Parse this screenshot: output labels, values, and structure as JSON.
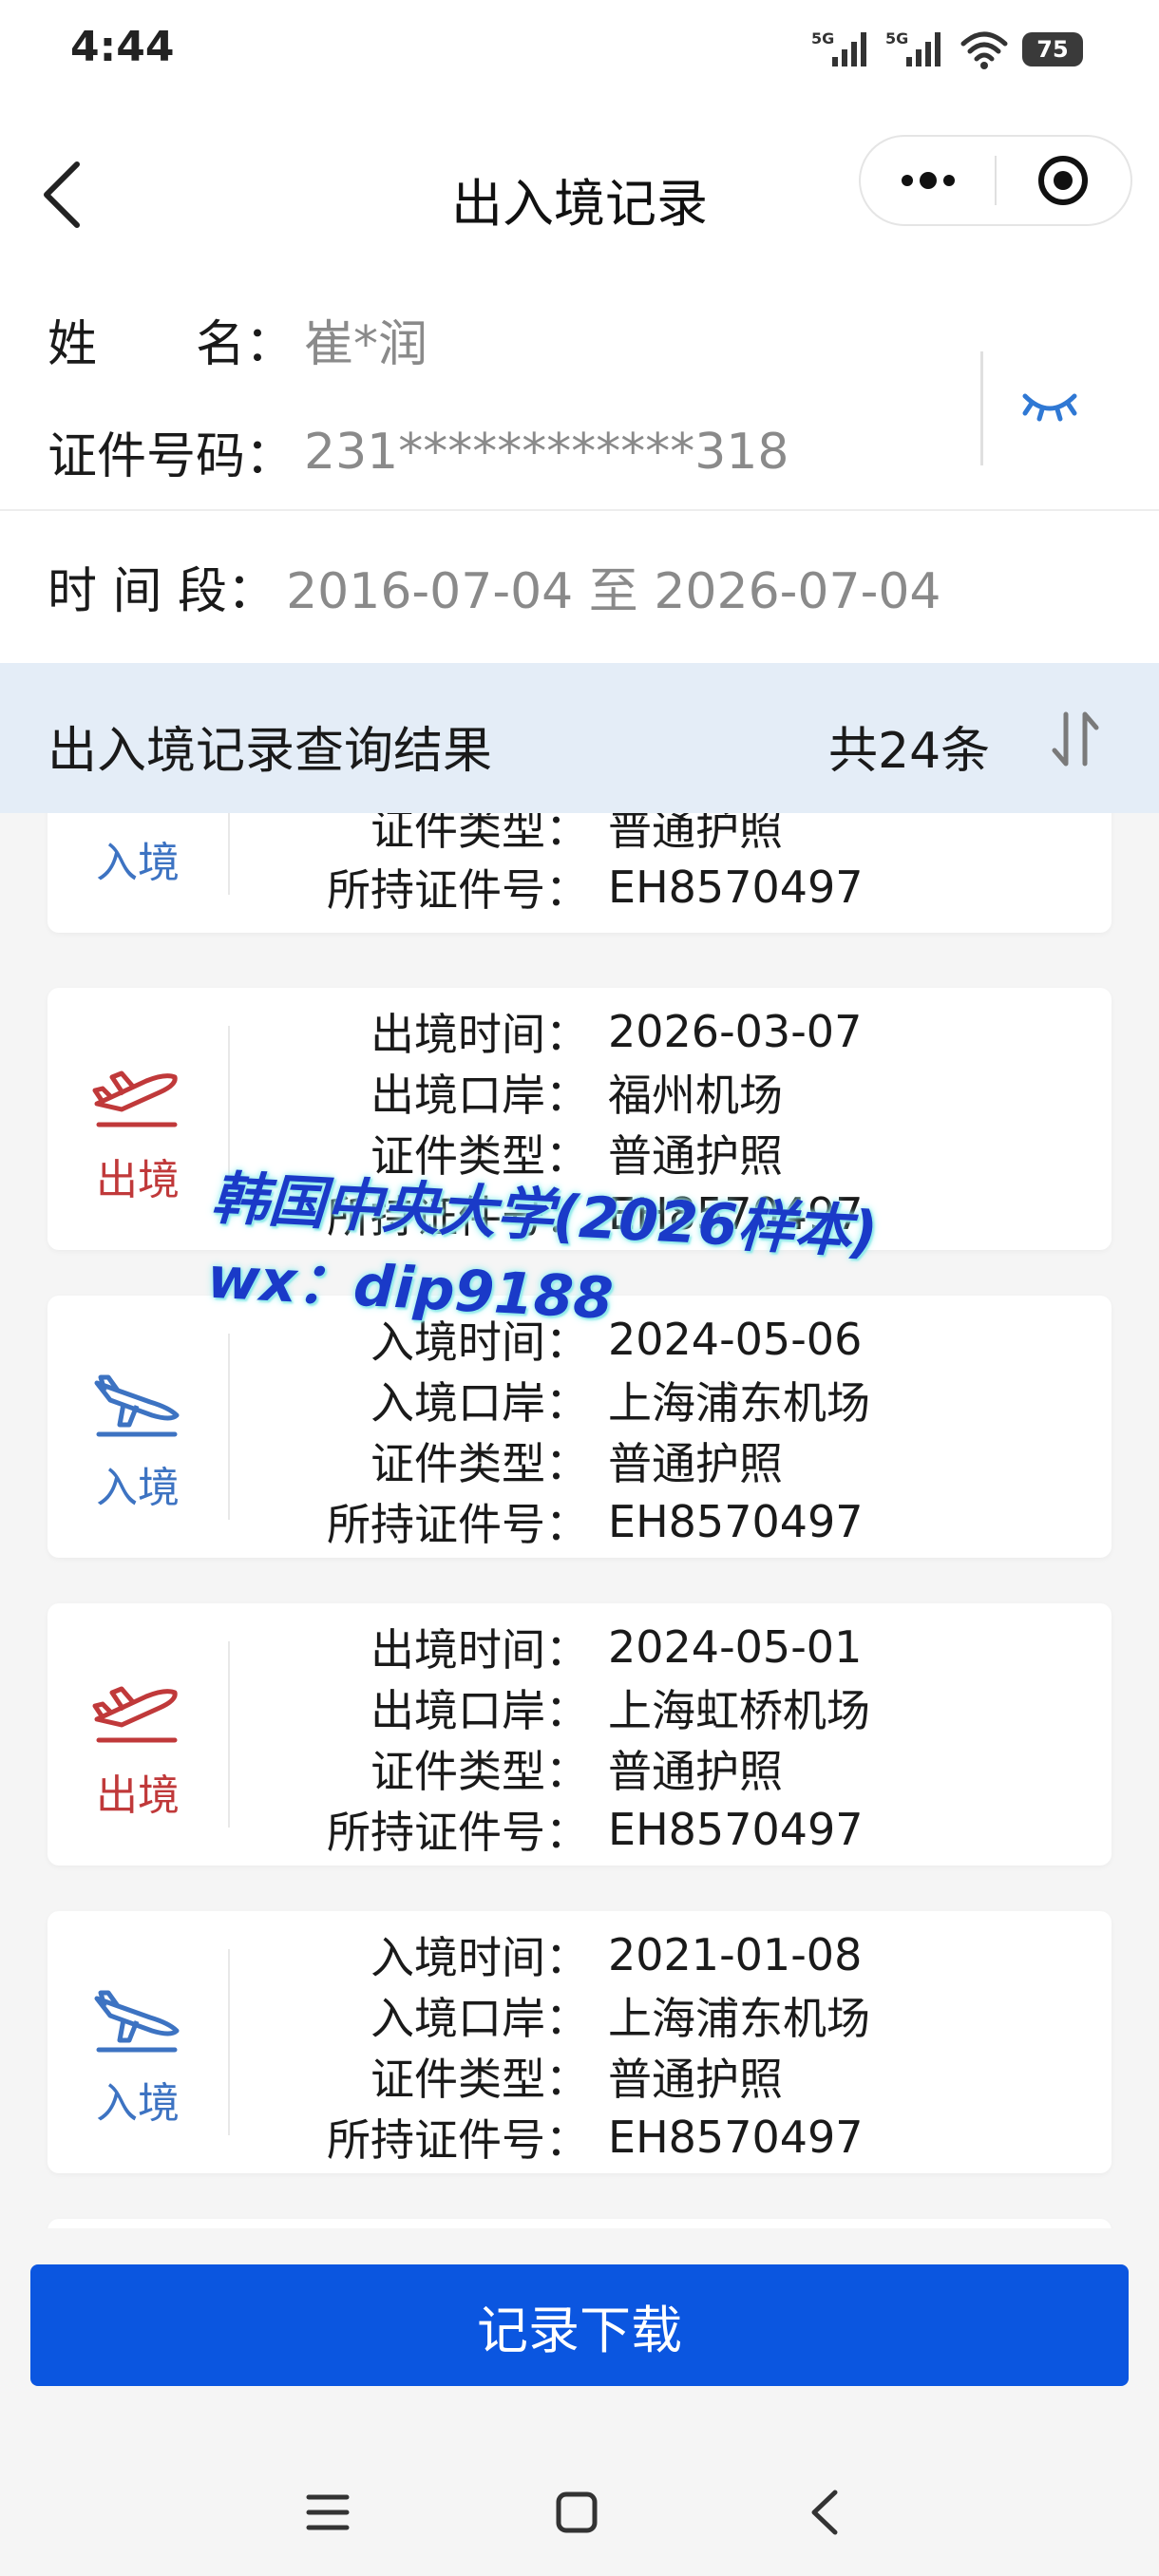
{
  "status_bar": {
    "time": "4:44",
    "network_1": "5G",
    "network_2": "5G",
    "battery": "75"
  },
  "nav": {
    "title": "出入境记录",
    "icons": [
      "back-chevron-icon",
      "more-dots-icon",
      "close-target-icon"
    ]
  },
  "info": {
    "name_label": "姓　　名：",
    "name_value": "崔*润",
    "id_label": "证件号码：",
    "id_value": "231************318",
    "period_label": "时 间 段：",
    "period_value": "2016-07-04 至 2026-07-04",
    "toggle_icon": "eye-closed-icon"
  },
  "results": {
    "title": "出入境记录查询结果",
    "count": "共24条",
    "sort_icon": "sort-arrows-icon"
  },
  "records": [
    {
      "direction": "入境",
      "type": "in",
      "fields": [
        {
          "label": "证件类型：",
          "value": "普通护照"
        },
        {
          "label": "所持证件号：",
          "value": "EH8570497"
        }
      ]
    },
    {
      "direction": "出境",
      "type": "out",
      "fields": [
        {
          "label": "出境时间：",
          "value": "2026-03-07"
        },
        {
          "label": "出境口岸：",
          "value": "福州机场"
        },
        {
          "label": "证件类型：",
          "value": "普通护照"
        },
        {
          "label": "所持证件号：",
          "value": "EH8570497"
        }
      ]
    },
    {
      "direction": "入境",
      "type": "in",
      "fields": [
        {
          "label": "入境时间：",
          "value": "2024-05-06"
        },
        {
          "label": "入境口岸：",
          "value": "上海浦东机场"
        },
        {
          "label": "证件类型：",
          "value": "普通护照"
        },
        {
          "label": "所持证件号：",
          "value": "EH8570497"
        }
      ]
    },
    {
      "direction": "出境",
      "type": "out",
      "fields": [
        {
          "label": "出境时间：",
          "value": "2024-05-01"
        },
        {
          "label": "出境口岸：",
          "value": "上海虹桥机场"
        },
        {
          "label": "证件类型：",
          "value": "普通护照"
        },
        {
          "label": "所持证件号：",
          "value": "EH8570497"
        }
      ]
    },
    {
      "direction": "入境",
      "type": "in",
      "fields": [
        {
          "label": "入境时间：",
          "value": "2021-01-08"
        },
        {
          "label": "入境口岸：",
          "value": "上海浦东机场"
        },
        {
          "label": "证件类型：",
          "value": "普通护照"
        },
        {
          "label": "所持证件号：",
          "value": "EH8570497"
        }
      ]
    }
  ],
  "watermark": {
    "line1": "韩国中央大学(2026样本)",
    "line2": "wx：dip9188"
  },
  "download_label": "记录下载",
  "colors": {
    "primary": "#0b56e0",
    "entry": "#3d73c2",
    "exit": "#c0393a",
    "header_bg": "#e4edf7"
  }
}
